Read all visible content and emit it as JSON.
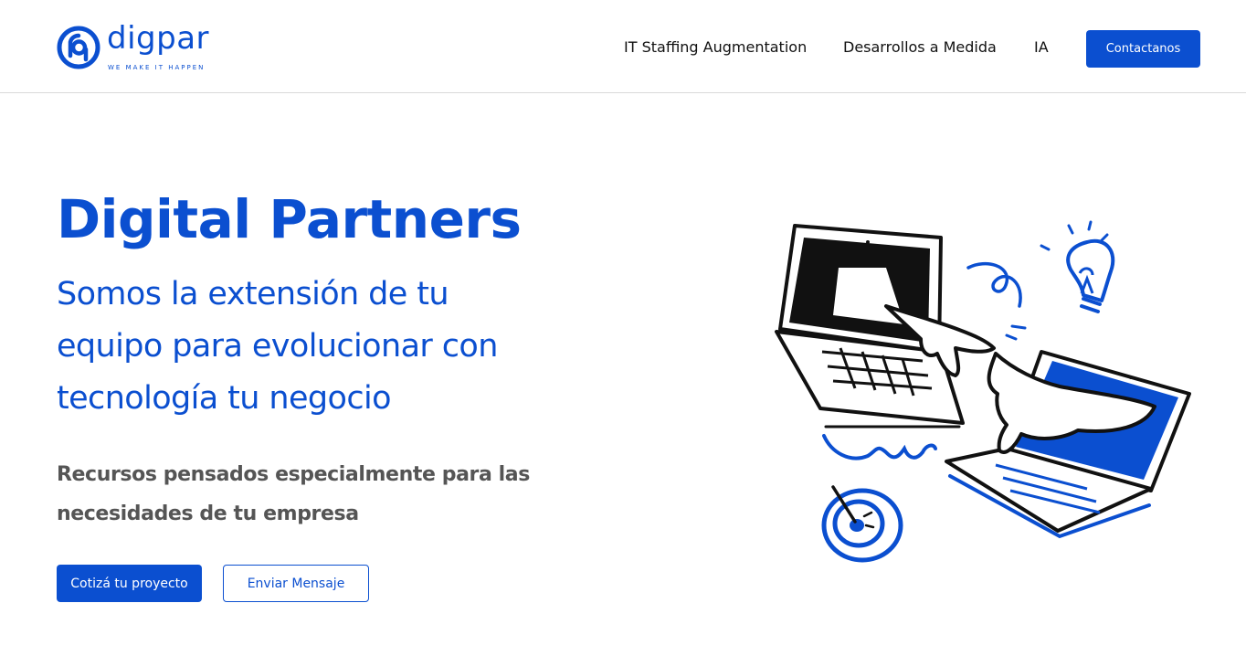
{
  "header": {
    "logo": {
      "wordmark": "digpar",
      "tagline": "WE MAKE IT HAPPEN"
    },
    "nav": [
      {
        "label": "IT Staffing Augmentation"
      },
      {
        "label": "Desarrollos a Medida"
      },
      {
        "label": "IA"
      }
    ],
    "cta_label": "Contactanos"
  },
  "hero": {
    "title": "Digital Partners",
    "subtitle_lines": [
      "Somos la extensión de tu",
      "equipo para evolucionar con",
      "tecnología tu negocio"
    ],
    "description_lines": [
      "Recursos pensados especialmente para las",
      "necesidades de tu empresa"
    ],
    "primary_button": "Cotizá tu proyecto",
    "secondary_button": "Enviar Mensaje",
    "illustration_icon": "laptops-handshake-illustration"
  },
  "colors": {
    "brand_blue": "#0b4fd0",
    "text_dark": "#111111",
    "text_gray": "#555555",
    "divider": "#d9d9d9"
  }
}
